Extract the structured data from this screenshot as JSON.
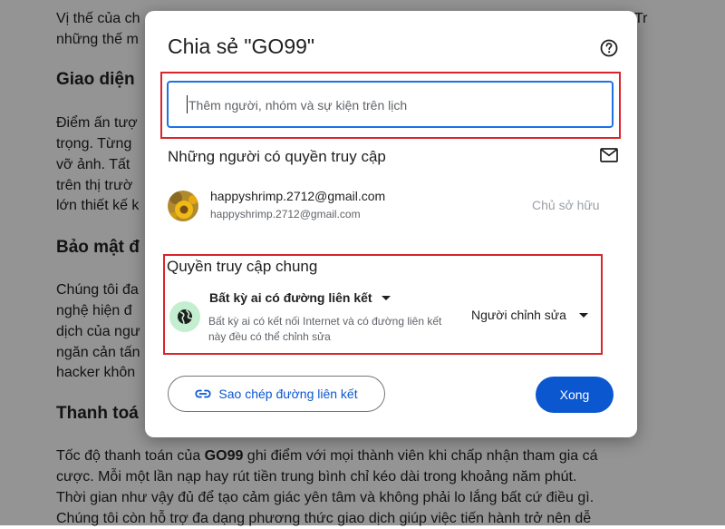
{
  "document": {
    "p1_l1": "Vị thế của ch",
    "p1_r1": "Tr",
    "p1_l2": "những thế m",
    "h_giao_dien": "Giao diện",
    "p2": [
      "Điểm ấn tượ",
      "trọng. Từng",
      "vỡ ảnh. Tất",
      "trên thị trườ",
      "lớn thiết kế k"
    ],
    "h_bao_mat": "Bảo mật đ",
    "p3": [
      "Chúng tôi đa",
      "nghệ hiện đ",
      "dịch của ngư",
      "ngăn cản tấn",
      "hacker khôn"
    ],
    "h_thanh_toan": "Thanh toá",
    "p4_l1_before": "Tốc độ thanh toán của ",
    "p4_l1_bold": "GO99",
    "p4_l1_after": " ghi điểm với mọi thành viên khi chấp nhận tham gia cá",
    "p4_l2": "cược. Mỗi một lần nạp hay rút tiền trung bình chỉ kéo dài trong khoảng năm phút.",
    "p4_l3": "Thời gian như vậy đủ để tạo cảm giác yên tâm và không phải lo lắng bất cứ điều gì.",
    "p4_l4": "Chúng tôi còn hỗ trợ đa dạng phương thức giao dịch giúp việc tiến hành trở nên dễ"
  },
  "dialog": {
    "title": "Chia sẻ \"GO99\"",
    "help_icon": "help-circle-icon",
    "input_placeholder": "Thêm người, nhóm và sự kiện trên lịch",
    "access_title": "Những người có quyền truy cập",
    "mail_icon": "mail-icon",
    "user": {
      "name": "happyshrimp.2712@gmail.com",
      "email": "happyshrimp.2712@gmail.com",
      "role": "Chủ sở hữu"
    },
    "general_title": "Quyền truy cập chung",
    "link_option": "Bất kỳ ai có đường liên kết",
    "link_desc": "Bất kỳ ai có kết nối Internet và có đường liên kết này đều có thể chỉnh sửa",
    "role_option": "Người chỉnh sửa",
    "copy_link": "Sao chép đường liên kết",
    "done": "Xong"
  },
  "colors": {
    "primary": "#0b57d0",
    "highlight": "#d9252b",
    "globe_bg": "#c4eed0"
  }
}
